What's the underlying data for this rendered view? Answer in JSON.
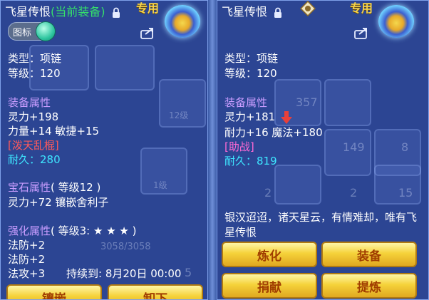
{
  "left": {
    "title": "飞星传恨",
    "title_status": "(当前装备)",
    "exclusive": "专用",
    "toggle_label": "图标",
    "type_line": "类型：项链",
    "level_line": "等级：120",
    "attr_header": "装备属性",
    "attr_spirit": "灵力+198",
    "attr_str_agi": "力量+14 敏捷+15",
    "special_skill": "[泼天乱棍]",
    "durability_label": "耐久：",
    "durability_value": "280",
    "gem_header": "宝石属性",
    "gem_level": "( 等级12 )",
    "gem_line": "灵力+72 镶嵌舍利子",
    "enhance_header": "强化属性",
    "enhance_level": "( 等级3: ★ ★ ★ )",
    "enhance_1": "法防+2",
    "enhance_2": "法防+2",
    "enhance_3": "法攻+3",
    "enhance_duration": "持续到: 8月20日 00:00",
    "btn_inlay": "镶嵌",
    "btn_unequip": "卸下",
    "ghost_numbers": [
      "12级",
      "1级",
      "5",
      "3058/3058"
    ]
  },
  "right": {
    "title": "飞星传恨",
    "exclusive": "专用",
    "type_line": "类型：项链",
    "level_line": "等级：120",
    "attr_header": "装备属性",
    "attr_spirit": "灵力+181",
    "attr_line2": "耐力+16 魔法+180",
    "special_skill": "[助战]",
    "durability_label": "耐久：",
    "durability_value": "819",
    "description": "银汉迢迢，诸天星云，有情难却，唯有飞星传恨",
    "btn_refine": "炼化",
    "btn_equip": "装备",
    "btn_donate": "捐献",
    "btn_extract": "提炼",
    "ghost_numbers": [
      "357",
      "149",
      "8",
      "2",
      "2",
      "15"
    ]
  },
  "colors": {
    "title_current": "#35e06a",
    "section_header": "#c99dff",
    "durability": "#3ee6ff",
    "special_left": "#ff5a5a",
    "special_right": "#ff6ad5",
    "button_text": "#a03d00",
    "panel_bg": "#2c4696"
  },
  "icons": [
    "lock-icon",
    "share-icon",
    "emblem-icon",
    "toggle-knob",
    "down-arrow-icon",
    "appraise-badge-icon"
  ]
}
